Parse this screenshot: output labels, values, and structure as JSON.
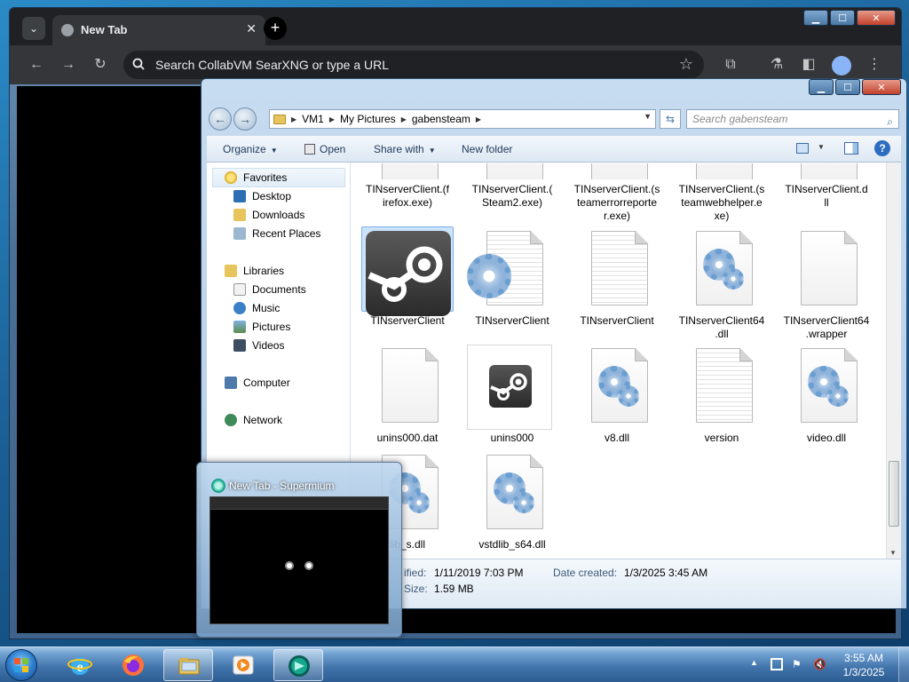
{
  "browser": {
    "tab_title": "New Tab",
    "tab_close": "✕",
    "new_tab": "+",
    "omnibox_placeholder": "Search CollabVM SearXNG or type a URL",
    "window_min": "▁",
    "window_max": "☐",
    "window_close": "✕"
  },
  "explorer": {
    "window_min": "▁",
    "window_max": "☐",
    "window_close": "✕",
    "breadcrumbs": [
      "VM1",
      "My Pictures",
      "gabensteam"
    ],
    "search_placeholder": "Search gabensteam",
    "commands": {
      "organize": "Organize",
      "open": "Open",
      "share_with": "Share with",
      "new_folder": "New folder"
    },
    "nav": {
      "favorites": "Favorites",
      "desktop": "Desktop",
      "downloads": "Downloads",
      "recent_places": "Recent Places",
      "libraries": "Libraries",
      "documents": "Documents",
      "music": "Music",
      "pictures": "Pictures",
      "videos": "Videos",
      "computer": "Computer",
      "network": "Network"
    },
    "files": [
      {
        "name": "TINserverClient.(firefox.exe)",
        "line1": "TINserverClient.(f",
        "line2": "irefox.exe)",
        "line3": ""
      },
      {
        "name": "TINserverClient.(Steam2.exe)",
        "line1": "TINserverClient.(",
        "line2": "Steam2.exe)",
        "line3": ""
      },
      {
        "name": "TINserverClient.(steamerrorreporter.exe)",
        "line1": "TINserverClient.(s",
        "line2": "teamerrorreporte",
        "line3": "r.exe)"
      },
      {
        "name": "TINserverClient.(steamwebhelper.exe)",
        "line1": "TINserverClient.(s",
        "line2": "teamwebhelper.e",
        "line3": "xe)"
      },
      {
        "name": "TINserverClient.dll",
        "line1": "TINserverClient.d",
        "line2": "ll",
        "line3": ""
      },
      {
        "name": "TINserverClient",
        "line1": "TINserverClient",
        "line2": "",
        "line3": ""
      },
      {
        "name": "TINserverClient",
        "line1": "TINserverClient",
        "line2": "",
        "line3": ""
      },
      {
        "name": "TINserverClient",
        "line1": "TINserverClient",
        "line2": "",
        "line3": ""
      },
      {
        "name": "TINserverClient64.dll",
        "line1": "TINserverClient64",
        "line2": ".dll",
        "line3": ""
      },
      {
        "name": "TINserverClient64.wrapper",
        "line1": "TINserverClient64",
        "line2": ".wrapper",
        "line3": ""
      },
      {
        "name": "unins000.dat",
        "line1": "unins000.dat",
        "line2": "",
        "line3": ""
      },
      {
        "name": "unins000",
        "line1": "unins000",
        "line2": "",
        "line3": ""
      },
      {
        "name": "v8.dll",
        "line1": "v8.dll",
        "line2": "",
        "line3": ""
      },
      {
        "name": "version",
        "line1": "version",
        "line2": "",
        "line3": ""
      },
      {
        "name": "video.dll",
        "line1": "video.dll",
        "line2": "",
        "line3": ""
      },
      {
        "name": "vstdlib_s.dll",
        "line1": "lib_s.dll",
        "line2": "",
        "line3": ""
      },
      {
        "name": "vstdlib_s64.dll",
        "line1": "vstdlib_s64.dll",
        "line2": "",
        "line3": ""
      }
    ],
    "details": {
      "modified_label": "ified:",
      "modified_value": "1/11/2019 7:03 PM",
      "created_label": "Date created:",
      "created_value": "1/3/2025 3:45 AM",
      "size_label": "Size:",
      "size_value": "1.59 MB"
    }
  },
  "preview": {
    "title": "New Tab - Supermium"
  },
  "taskbar": {
    "time": "3:55 AM",
    "date": "1/3/2025"
  },
  "colors": {
    "selection": "#cce4fb",
    "chrome_dark": "#202124",
    "taskbar_blue": "#3f72a9"
  }
}
